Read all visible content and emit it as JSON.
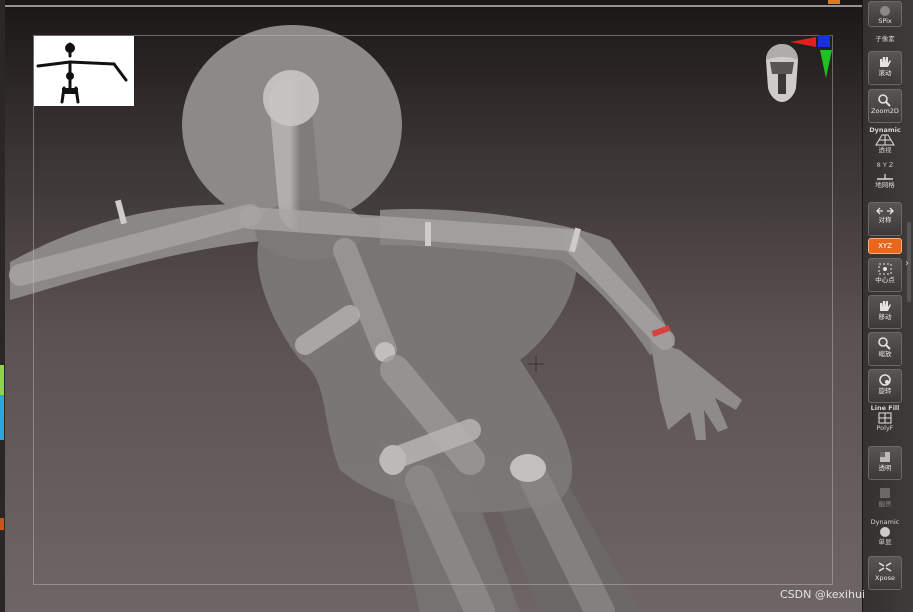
{
  "toolbar": {
    "top_label": "SPix",
    "subpixel_label": "子像素",
    "buttons": [
      {
        "id": "move",
        "label": "滚动"
      },
      {
        "id": "zoom2d",
        "label": "Zoom2D"
      },
      {
        "id": "dynamic",
        "label": "透视",
        "caption": "Dynamic"
      },
      {
        "id": "floor",
        "label": "地网格"
      },
      {
        "id": "local",
        "label": "对称"
      },
      {
        "id": "xyz",
        "label": "XYZ"
      },
      {
        "id": "center",
        "label": "中心点"
      },
      {
        "id": "pan",
        "label": "移动"
      },
      {
        "id": "scale",
        "label": "缩放"
      },
      {
        "id": "rotate",
        "label": "旋转"
      },
      {
        "id": "polyf",
        "label": "PolyF",
        "caption": "Line Fill"
      },
      {
        "id": "transp",
        "label": "透明"
      },
      {
        "id": "ghost",
        "label": "幽灵"
      },
      {
        "id": "solo",
        "label": "单显",
        "caption": "Dynamic"
      },
      {
        "id": "xpose",
        "label": "Xpose"
      }
    ],
    "axis_label": "8 Y Z"
  },
  "watermark": "CSDN @kexihui",
  "colors": {
    "accent": "#e9661b",
    "axis_x": "#e02020",
    "axis_y": "#20c020",
    "axis_z": "#1830e0",
    "joint_band": "#d94040"
  },
  "icons": [
    "stick-figure-thumbnail",
    "head-orientation-icon",
    "axis-gizmo-icon"
  ]
}
